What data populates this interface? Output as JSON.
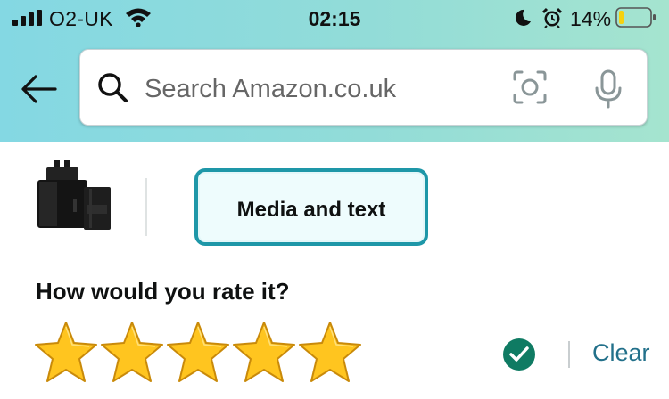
{
  "status_bar": {
    "carrier": "O2-UK",
    "time": "02:15",
    "battery_percent": "14%",
    "battery_level": 0.14,
    "battery_color": "#f5d10f",
    "icons": [
      "signal-icon",
      "wifi-icon",
      "moon-icon",
      "alarm-icon",
      "battery-icon"
    ]
  },
  "header": {
    "search_placeholder": "Search Amazon.co.uk",
    "icons": [
      "back-arrow-icon",
      "search-icon",
      "camera-icon",
      "microphone-icon"
    ]
  },
  "review": {
    "media_button_label": "Media and text",
    "rating_question": "How would you rate it?",
    "rating_value": 5,
    "rating_max": 5,
    "clear_label": "Clear",
    "accent_color": "#1e97a8",
    "check_color": "#0f7b63",
    "star_color": "#ffc51f"
  }
}
